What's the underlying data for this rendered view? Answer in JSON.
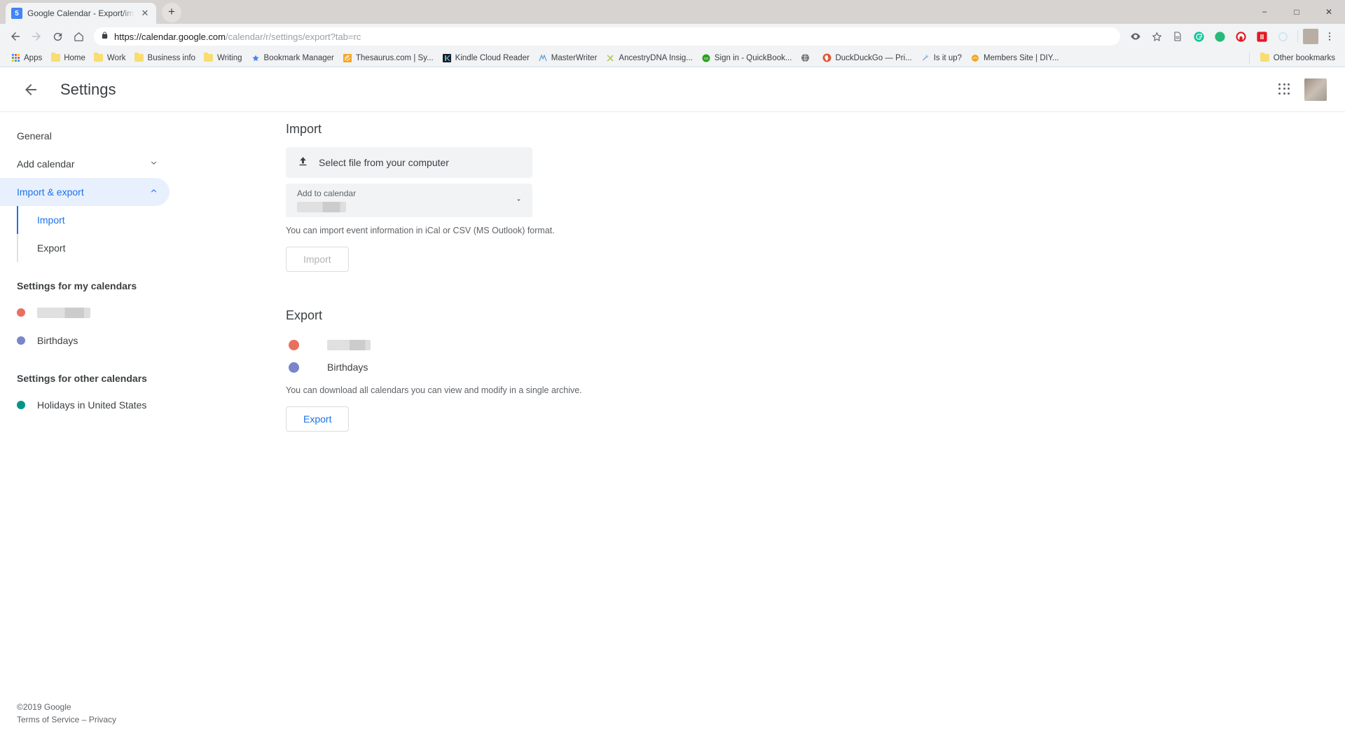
{
  "browser": {
    "tab": {
      "title": "Google Calendar - Export/import",
      "favicon_label": "5",
      "close_icon": "close-icon"
    },
    "newtab_label": "+",
    "window_controls": {
      "minimize": "−",
      "maximize": "□",
      "close": "✕"
    },
    "nav": {
      "back": "←",
      "forward": "→",
      "reload": "↻",
      "home": "⌂"
    },
    "omnibox": {
      "lock_icon": "lock-icon",
      "url_scheme_host": "https://calendar.google.com",
      "url_path": "/calendar/r/settings/export?tab=rc",
      "full_url": "https://calendar.google.com/calendar/r/settings/export?tab=rc"
    },
    "toolbar_right_icons": [
      "eye-icon",
      "star-icon",
      "reader-icon",
      "grammarly-icon",
      "green-bubble-icon",
      "adblock-icon",
      "pocket-icon",
      "circle-loading-icon"
    ],
    "bookmarks": [
      {
        "label": "Apps",
        "icon": "apps-grid-icon"
      },
      {
        "label": "Home",
        "icon": "folder-icon"
      },
      {
        "label": "Work",
        "icon": "folder-icon"
      },
      {
        "label": "Business info",
        "icon": "folder-icon"
      },
      {
        "label": "Writing",
        "icon": "folder-icon"
      },
      {
        "label": "Bookmark Manager",
        "icon": "star-icon"
      },
      {
        "label": "Thesaurus.com | Sy...",
        "icon": "thesaurus-icon"
      },
      {
        "label": "Kindle Cloud Reader",
        "icon": "kindle-icon"
      },
      {
        "label": "MasterWriter",
        "icon": "masterwriter-icon"
      },
      {
        "label": "AncestryDNA Insig...",
        "icon": "ancestry-icon"
      },
      {
        "label": "Sign in - QuickBook...",
        "icon": "quickbooks-icon"
      },
      {
        "label": "",
        "icon": "globe-icon"
      },
      {
        "label": "DuckDuckGo — Pri...",
        "icon": "duckduckgo-icon"
      },
      {
        "label": "Is it up?",
        "icon": "wrench-icon"
      },
      {
        "label": "Members Site | DIY...",
        "icon": "diy-icon"
      }
    ],
    "other_bookmarks": {
      "label": "Other bookmarks",
      "icon": "folder-icon"
    }
  },
  "app": {
    "header": {
      "back_icon": "back-arrow-icon",
      "title": "Settings",
      "apps_icon": "google-apps-icon",
      "avatar": "user-avatar"
    },
    "sidebar": {
      "items": [
        {
          "label": "General",
          "type": "nav",
          "active": false
        },
        {
          "label": "Add calendar",
          "type": "nav-expandable",
          "active": false,
          "chevron": "⌄"
        },
        {
          "label": "Import & export",
          "type": "nav-expandable",
          "active": true,
          "chevron": "⌃"
        }
      ],
      "subitems": [
        {
          "label": "Import",
          "active": true
        },
        {
          "label": "Export",
          "active": false
        }
      ],
      "my_calendars_title": "Settings for my calendars",
      "my_calendars": [
        {
          "label": "",
          "redacted": true,
          "color": "#e8705f"
        },
        {
          "label": "Birthdays",
          "redacted": false,
          "color": "#7986cb"
        }
      ],
      "other_calendars_title": "Settings for other calendars",
      "other_calendars": [
        {
          "label": "Holidays in United States",
          "redacted": false,
          "color": "#009688"
        }
      ]
    },
    "import": {
      "heading": "Import",
      "file_picker_label": "Select file from your computer",
      "file_picker_icon": "upload-icon",
      "select_label": "Add to calendar",
      "select_value": "",
      "select_value_redacted": true,
      "select_arrow_icon": "chevron-down-icon",
      "helper_text": "You can import event information in iCal or CSV (MS Outlook) format.",
      "button_label": "Import",
      "button_disabled": true
    },
    "export": {
      "heading": "Export",
      "calendars": [
        {
          "label": "",
          "redacted": true,
          "color": "#e8705f"
        },
        {
          "label": "Birthdays",
          "redacted": false,
          "color": "#7986cb"
        }
      ],
      "helper_text": "You can download all calendars you can view and modify in a single archive.",
      "button_label": "Export"
    },
    "footer": {
      "copyright": "©2019 Google",
      "terms": "Terms of Service",
      "separator": " – ",
      "privacy": "Privacy"
    }
  },
  "colors": {
    "accent": "#1a73e8",
    "active_bg": "#e8f0fe",
    "text": "#3c4043",
    "muted": "#5f6368"
  }
}
